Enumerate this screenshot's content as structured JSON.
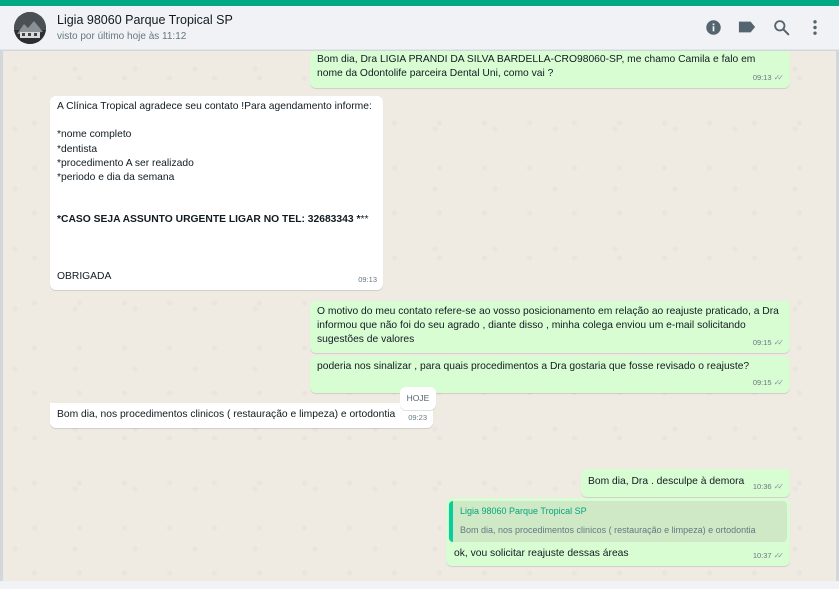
{
  "header": {
    "contact_name": "Ligia 98060 Parque Tropical SP",
    "status": "visto por último hoje às 11:12",
    "icons": [
      "info-icon",
      "label-icon",
      "search-icon",
      "menu-icon"
    ]
  },
  "colors": {
    "accent": "#00a884",
    "outgoing": "#d9fdd3",
    "incoming": "#ffffff",
    "chat_bg": "#efeae2"
  },
  "messages": [
    {
      "text": "Bom dia, Dra LIGIA PRANDI DA SILVA BARDELLA-CRO98060-SP, me chamo Camila e falo em nome da Odontolife parceira Dental Uni, como vai ?",
      "time": "09:13"
    },
    {
      "text": "A Clínica Tropical agradece seu contato !Para agendamento informe:\n\n*nome completo\n*dentista\n*procedimento A ser realizado\n*periodo e dia da semana",
      "bold_text": "*CASO SEJA ASSUNTO URGENTE LIGAR NO TEL: 32683343 *",
      "bold_suffix": "**",
      "closing": "OBRIGADA",
      "time": "09:13"
    },
    {
      "text": "O motivo do meu contato refere-se ao vosso posicionamento em relação ao reajuste praticado, a Dra informou que não foi do seu agrado , diante disso , minha colega enviou um e-mail solicitando sugestões de valores",
      "time": "09:15"
    },
    {
      "text": "poderia nos sinalizar , para quais procedimentos a Dra gostaria que fosse revisado o reajuste?",
      "time": "09:15"
    },
    {
      "text": "Bom dia, nos procedimentos clinicos ( restauração e limpeza) e ortodontia",
      "time": "09:23"
    },
    {
      "text": "Bom dia, Dra . desculpe à demora",
      "time": "10:36"
    },
    {
      "quote_author": "Ligia 98060 Parque Tropical SP",
      "quote_text": "Bom dia, nos procedimentos clinicos ( restauração e limpeza) e ortodontia",
      "text": "ok, vou solicitar reajuste dessas áreas",
      "time": "10:37"
    }
  ],
  "day_divider": "HOJE"
}
